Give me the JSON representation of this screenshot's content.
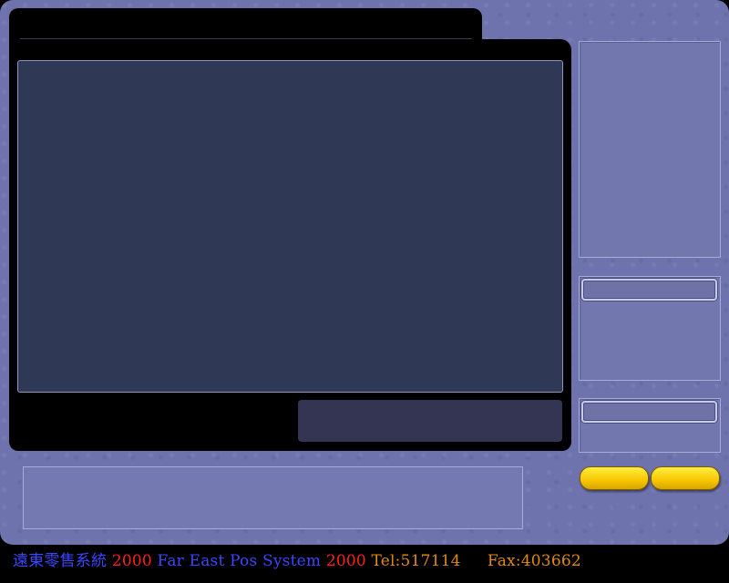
{
  "footer": {
    "system_cn": "遠東零售系統",
    "year_1": "2000",
    "product_name": "Far East Pos System",
    "year_2": "2000",
    "tel": "Tel:517114",
    "fax": "Fax:403662"
  },
  "colors": {
    "frame": "#6f73ad",
    "display_bg": "#2f3955",
    "footer_blue": "#3b46ff",
    "footer_red": "#ff1f1f",
    "footer_orange": "#e08a10",
    "button_yellow": "#f7c600"
  }
}
